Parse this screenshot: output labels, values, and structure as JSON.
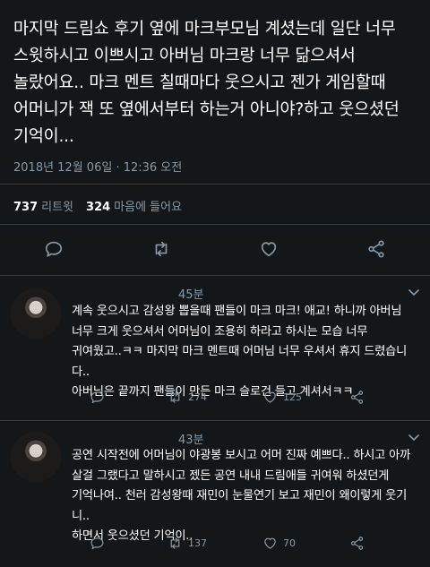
{
  "tweet": {
    "text": "마지막 드림쇼 후기 옆에 마크부모님 계셨는데 일단 너무\n스윗하시고 이쁘시고 아버님 마크랑 너무 닮으셔서\n놀랐어요.. 마크 멘트 칠때마다 웃으시고 젠가 게임할때\n어머니가 잭 또 옆에서부터 하는거 아니야?하고 웃으셨던\n기억이...",
    "timestamp": "2018년 12월 06일 · 12:36 오전",
    "retweet_count": "737",
    "retweet_label": "리트윗",
    "like_count": "324",
    "like_label": "마음에 들어요"
  },
  "replies": [
    {
      "name": "",
      "time": "45분",
      "text": "계속 웃으시고 감성왕 뽑을때 팬들이 마크 마크! 애교! 하니까 아버님\n너무 크게 웃으셔서 어머님이 조용히 하라고 하시는 모습 너무\n귀여웠고..ㅋㅋ 마지막 마크 멘트때 어머님 너무 우셔서 휴지 드렸습니다..\n아버님은 끝까지 팬들이 만든 마크 슬로건 들고 계셔서ㅋㅋ",
      "retweets": "274",
      "likes": "125"
    },
    {
      "name": "",
      "time": "43분",
      "text": "공연 시작전에 어머님이 야광봉 보시고 어머 진짜 예쁘다.. 하시고 아까\n살걸 그랬다고 말하시고 젰든 공연 내내 드림애들 귀여워 하셨던게\n기억나여.. 천러 감성왕때 재민이 눈물연기 보고 재민이 왜이렇게 웃기니..\n하면서 웃으셨던 기억이..",
      "retweets": "137",
      "likes": "70"
    }
  ],
  "icons": {
    "reply": "reply-icon",
    "retweet": "retweet-icon",
    "like": "heart-icon",
    "share": "share-icon",
    "more": "chevron-down-icon"
  },
  "colors": {
    "background": "#14171a",
    "text": "#ffffff",
    "muted": "#8899a6",
    "divider": "#2f3b45"
  }
}
